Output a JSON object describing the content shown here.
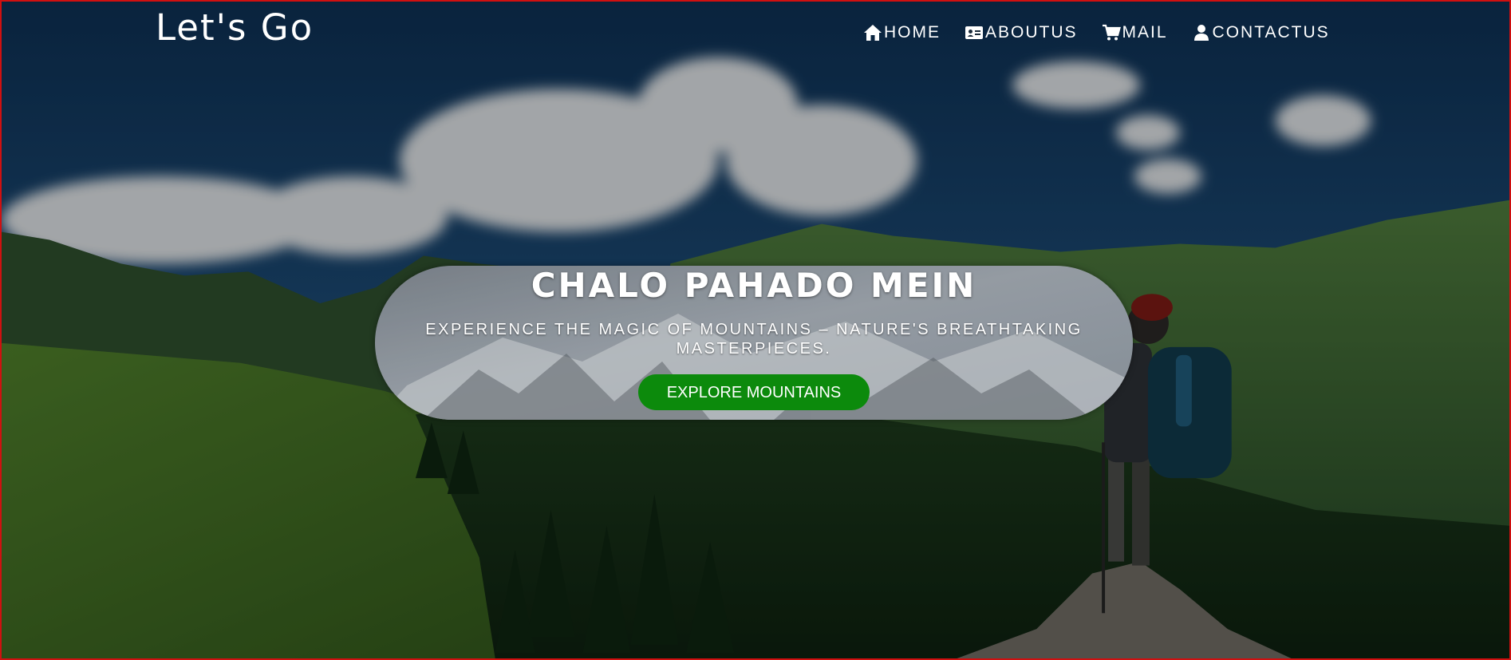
{
  "brand": {
    "logo": "Let's Go"
  },
  "nav": {
    "items": [
      {
        "label": "HOME",
        "icon": "home-icon"
      },
      {
        "label": "ABOUTUS",
        "icon": "id-card-icon"
      },
      {
        "label": "MAIL",
        "icon": "cart-icon"
      },
      {
        "label": "CONTACTUS",
        "icon": "user-icon"
      }
    ]
  },
  "hero": {
    "title": "CHALO PAHADO MEIN",
    "subtitle": "EXPERIENCE THE MAGIC OF MOUNTAINS – NATURE'S BREATHTAKING MASTERPIECES.",
    "button_label": "EXPLORE MOUNTAINS"
  },
  "colors": {
    "button": "#0c8a0c",
    "text": "#ffffff",
    "border": "#d01010"
  }
}
